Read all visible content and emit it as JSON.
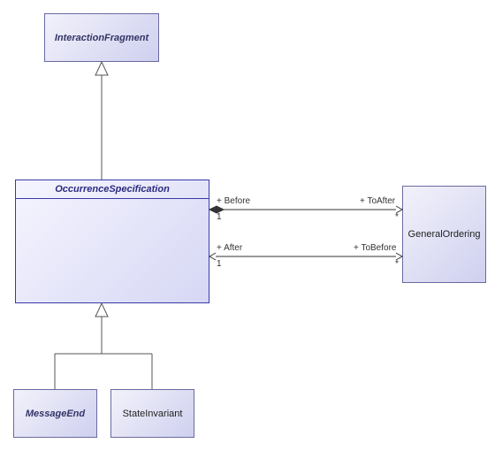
{
  "classes": {
    "interactionFragment": {
      "name": "InteractionFragment"
    },
    "occurrenceSpecification": {
      "name": "OccurrenceSpecification"
    },
    "generalOrdering": {
      "name": "GeneralOrdering"
    },
    "messageEnd": {
      "name": "MessageEnd"
    },
    "stateInvariant": {
      "name": "StateInvariant"
    }
  },
  "associations": {
    "top": {
      "leftRole": "+ Before",
      "leftMult": "1",
      "rightRole": "+ ToAfter",
      "rightMult": "*"
    },
    "bottom": {
      "leftRole": "+ After",
      "leftMult": "1",
      "rightRole": "+ ToBefore",
      "rightMult": "*"
    }
  }
}
